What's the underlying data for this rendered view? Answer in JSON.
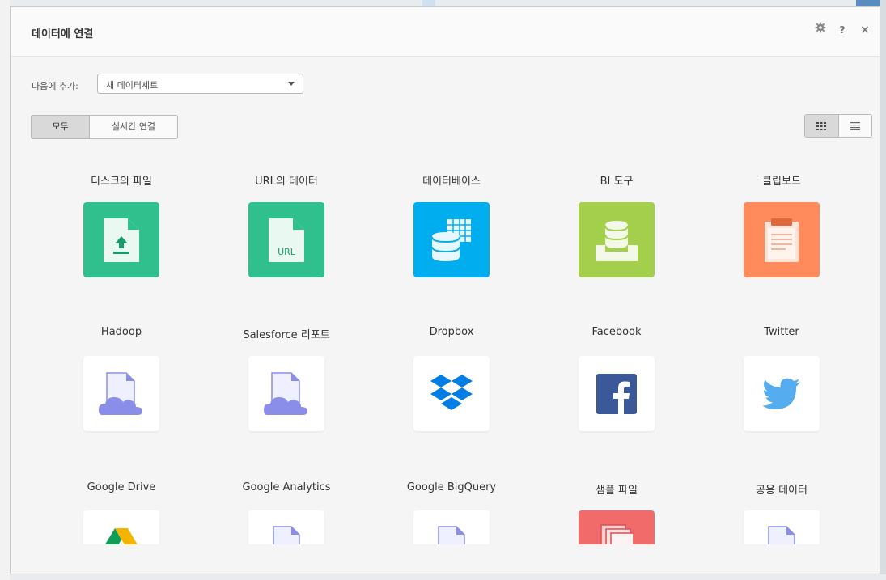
{
  "dialog": {
    "title": "데이터에 연결",
    "help_label": "?",
    "close_label": "×"
  },
  "add_to": {
    "label": "다음에 추가:",
    "selected": "새 데이터세트"
  },
  "filters": {
    "all": "모두",
    "live": "실시간 연결"
  },
  "colors": {
    "green": "#30c08e",
    "blue": "#00aeef",
    "lime": "#a4cf4c",
    "orange": "#ff8a5b",
    "red": "#f26b6b",
    "facebook": "#3b5998",
    "twitter": "#55acee",
    "dropbox": "#007ee5",
    "cloud": "#8a8ee8"
  },
  "sources": [
    {
      "label": "디스크의 파일",
      "icon": "file-upload-icon",
      "url_text": ""
    },
    {
      "label": "URL의 데이터",
      "icon": "url-file-icon",
      "url_text": "URL"
    },
    {
      "label": "데이터베이스",
      "icon": "database-icon",
      "url_text": ""
    },
    {
      "label": "BI 도구",
      "icon": "bi-tool-icon",
      "url_text": ""
    },
    {
      "label": "클립보드",
      "icon": "clipboard-icon",
      "url_text": ""
    },
    {
      "label": "Hadoop",
      "icon": "cloud-file-icon",
      "url_text": ""
    },
    {
      "label": "Salesforce 리포트",
      "icon": "cloud-file-icon",
      "url_text": ""
    },
    {
      "label": "Dropbox",
      "icon": "dropbox-icon",
      "url_text": ""
    },
    {
      "label": "Facebook",
      "icon": "facebook-icon",
      "url_text": ""
    },
    {
      "label": "Twitter",
      "icon": "twitter-icon",
      "url_text": ""
    },
    {
      "label": "Google Drive",
      "icon": "google-drive-icon",
      "url_text": ""
    },
    {
      "label": "Google Analytics",
      "icon": "file-icon",
      "url_text": ""
    },
    {
      "label": "Google BigQuery",
      "icon": "file-icon",
      "url_text": ""
    },
    {
      "label": "샘플 파일",
      "icon": "sample-files-icon",
      "url_text": ""
    },
    {
      "label": "공용 데이터",
      "icon": "file-icon",
      "url_text": ""
    }
  ]
}
